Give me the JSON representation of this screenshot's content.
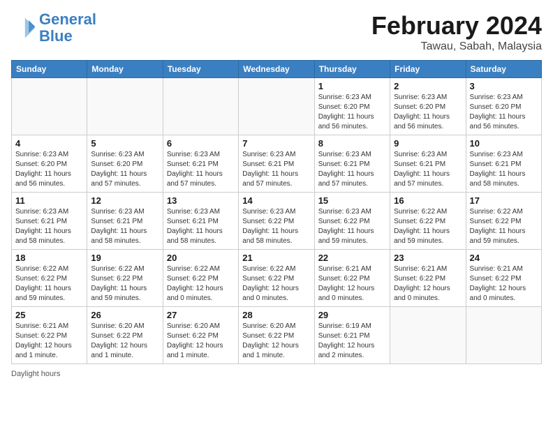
{
  "header": {
    "logo_line1": "General",
    "logo_line2": "Blue",
    "month_title": "February 2024",
    "location": "Tawau, Sabah, Malaysia"
  },
  "days_of_week": [
    "Sunday",
    "Monday",
    "Tuesday",
    "Wednesday",
    "Thursday",
    "Friday",
    "Saturday"
  ],
  "weeks": [
    [
      {
        "day": "",
        "info": ""
      },
      {
        "day": "",
        "info": ""
      },
      {
        "day": "",
        "info": ""
      },
      {
        "day": "",
        "info": ""
      },
      {
        "day": "1",
        "info": "Sunrise: 6:23 AM\nSunset: 6:20 PM\nDaylight: 11 hours and 56 minutes."
      },
      {
        "day": "2",
        "info": "Sunrise: 6:23 AM\nSunset: 6:20 PM\nDaylight: 11 hours and 56 minutes."
      },
      {
        "day": "3",
        "info": "Sunrise: 6:23 AM\nSunset: 6:20 PM\nDaylight: 11 hours and 56 minutes."
      }
    ],
    [
      {
        "day": "4",
        "info": "Sunrise: 6:23 AM\nSunset: 6:20 PM\nDaylight: 11 hours and 56 minutes."
      },
      {
        "day": "5",
        "info": "Sunrise: 6:23 AM\nSunset: 6:20 PM\nDaylight: 11 hours and 57 minutes."
      },
      {
        "day": "6",
        "info": "Sunrise: 6:23 AM\nSunset: 6:21 PM\nDaylight: 11 hours and 57 minutes."
      },
      {
        "day": "7",
        "info": "Sunrise: 6:23 AM\nSunset: 6:21 PM\nDaylight: 11 hours and 57 minutes."
      },
      {
        "day": "8",
        "info": "Sunrise: 6:23 AM\nSunset: 6:21 PM\nDaylight: 11 hours and 57 minutes."
      },
      {
        "day": "9",
        "info": "Sunrise: 6:23 AM\nSunset: 6:21 PM\nDaylight: 11 hours and 57 minutes."
      },
      {
        "day": "10",
        "info": "Sunrise: 6:23 AM\nSunset: 6:21 PM\nDaylight: 11 hours and 58 minutes."
      }
    ],
    [
      {
        "day": "11",
        "info": "Sunrise: 6:23 AM\nSunset: 6:21 PM\nDaylight: 11 hours and 58 minutes."
      },
      {
        "day": "12",
        "info": "Sunrise: 6:23 AM\nSunset: 6:21 PM\nDaylight: 11 hours and 58 minutes."
      },
      {
        "day": "13",
        "info": "Sunrise: 6:23 AM\nSunset: 6:21 PM\nDaylight: 11 hours and 58 minutes."
      },
      {
        "day": "14",
        "info": "Sunrise: 6:23 AM\nSunset: 6:22 PM\nDaylight: 11 hours and 58 minutes."
      },
      {
        "day": "15",
        "info": "Sunrise: 6:23 AM\nSunset: 6:22 PM\nDaylight: 11 hours and 59 minutes."
      },
      {
        "day": "16",
        "info": "Sunrise: 6:22 AM\nSunset: 6:22 PM\nDaylight: 11 hours and 59 minutes."
      },
      {
        "day": "17",
        "info": "Sunrise: 6:22 AM\nSunset: 6:22 PM\nDaylight: 11 hours and 59 minutes."
      }
    ],
    [
      {
        "day": "18",
        "info": "Sunrise: 6:22 AM\nSunset: 6:22 PM\nDaylight: 11 hours and 59 minutes."
      },
      {
        "day": "19",
        "info": "Sunrise: 6:22 AM\nSunset: 6:22 PM\nDaylight: 11 hours and 59 minutes."
      },
      {
        "day": "20",
        "info": "Sunrise: 6:22 AM\nSunset: 6:22 PM\nDaylight: 12 hours and 0 minutes."
      },
      {
        "day": "21",
        "info": "Sunrise: 6:22 AM\nSunset: 6:22 PM\nDaylight: 12 hours and 0 minutes."
      },
      {
        "day": "22",
        "info": "Sunrise: 6:21 AM\nSunset: 6:22 PM\nDaylight: 12 hours and 0 minutes."
      },
      {
        "day": "23",
        "info": "Sunrise: 6:21 AM\nSunset: 6:22 PM\nDaylight: 12 hours and 0 minutes."
      },
      {
        "day": "24",
        "info": "Sunrise: 6:21 AM\nSunset: 6:22 PM\nDaylight: 12 hours and 0 minutes."
      }
    ],
    [
      {
        "day": "25",
        "info": "Sunrise: 6:21 AM\nSunset: 6:22 PM\nDaylight: 12 hours and 1 minute."
      },
      {
        "day": "26",
        "info": "Sunrise: 6:20 AM\nSunset: 6:22 PM\nDaylight: 12 hours and 1 minute."
      },
      {
        "day": "27",
        "info": "Sunrise: 6:20 AM\nSunset: 6:22 PM\nDaylight: 12 hours and 1 minute."
      },
      {
        "day": "28",
        "info": "Sunrise: 6:20 AM\nSunset: 6:22 PM\nDaylight: 12 hours and 1 minute."
      },
      {
        "day": "29",
        "info": "Sunrise: 6:19 AM\nSunset: 6:21 PM\nDaylight: 12 hours and 2 minutes."
      },
      {
        "day": "",
        "info": ""
      },
      {
        "day": "",
        "info": ""
      }
    ]
  ],
  "footer": {
    "daylight_label": "Daylight hours"
  }
}
